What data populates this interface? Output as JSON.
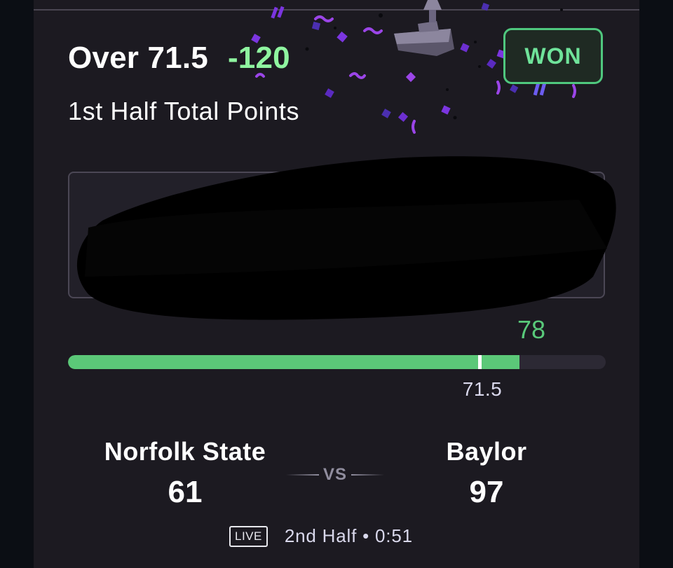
{
  "bet": {
    "selection": "Over 71.5",
    "odds": "-120",
    "market": "1st Half Total Points",
    "result": "WON"
  },
  "progress": {
    "current_value": "78",
    "line_label": "71.5",
    "fill_fraction": 0.84,
    "line_fraction": 0.76
  },
  "matchup": {
    "home": {
      "name": "Norfolk State",
      "score": "61"
    },
    "away": {
      "name": "Baylor",
      "score": "97"
    },
    "vs_label": "VS"
  },
  "status": {
    "live_label": "LIVE",
    "game_clock": "2nd Half • 0:51"
  },
  "colors": {
    "accent_green": "#5bc878",
    "odds_green": "#8ff5a0",
    "card_background": "#1c1a21"
  },
  "icons": {
    "trophy": "trophy-icon",
    "confetti": "confetti-decoration"
  }
}
